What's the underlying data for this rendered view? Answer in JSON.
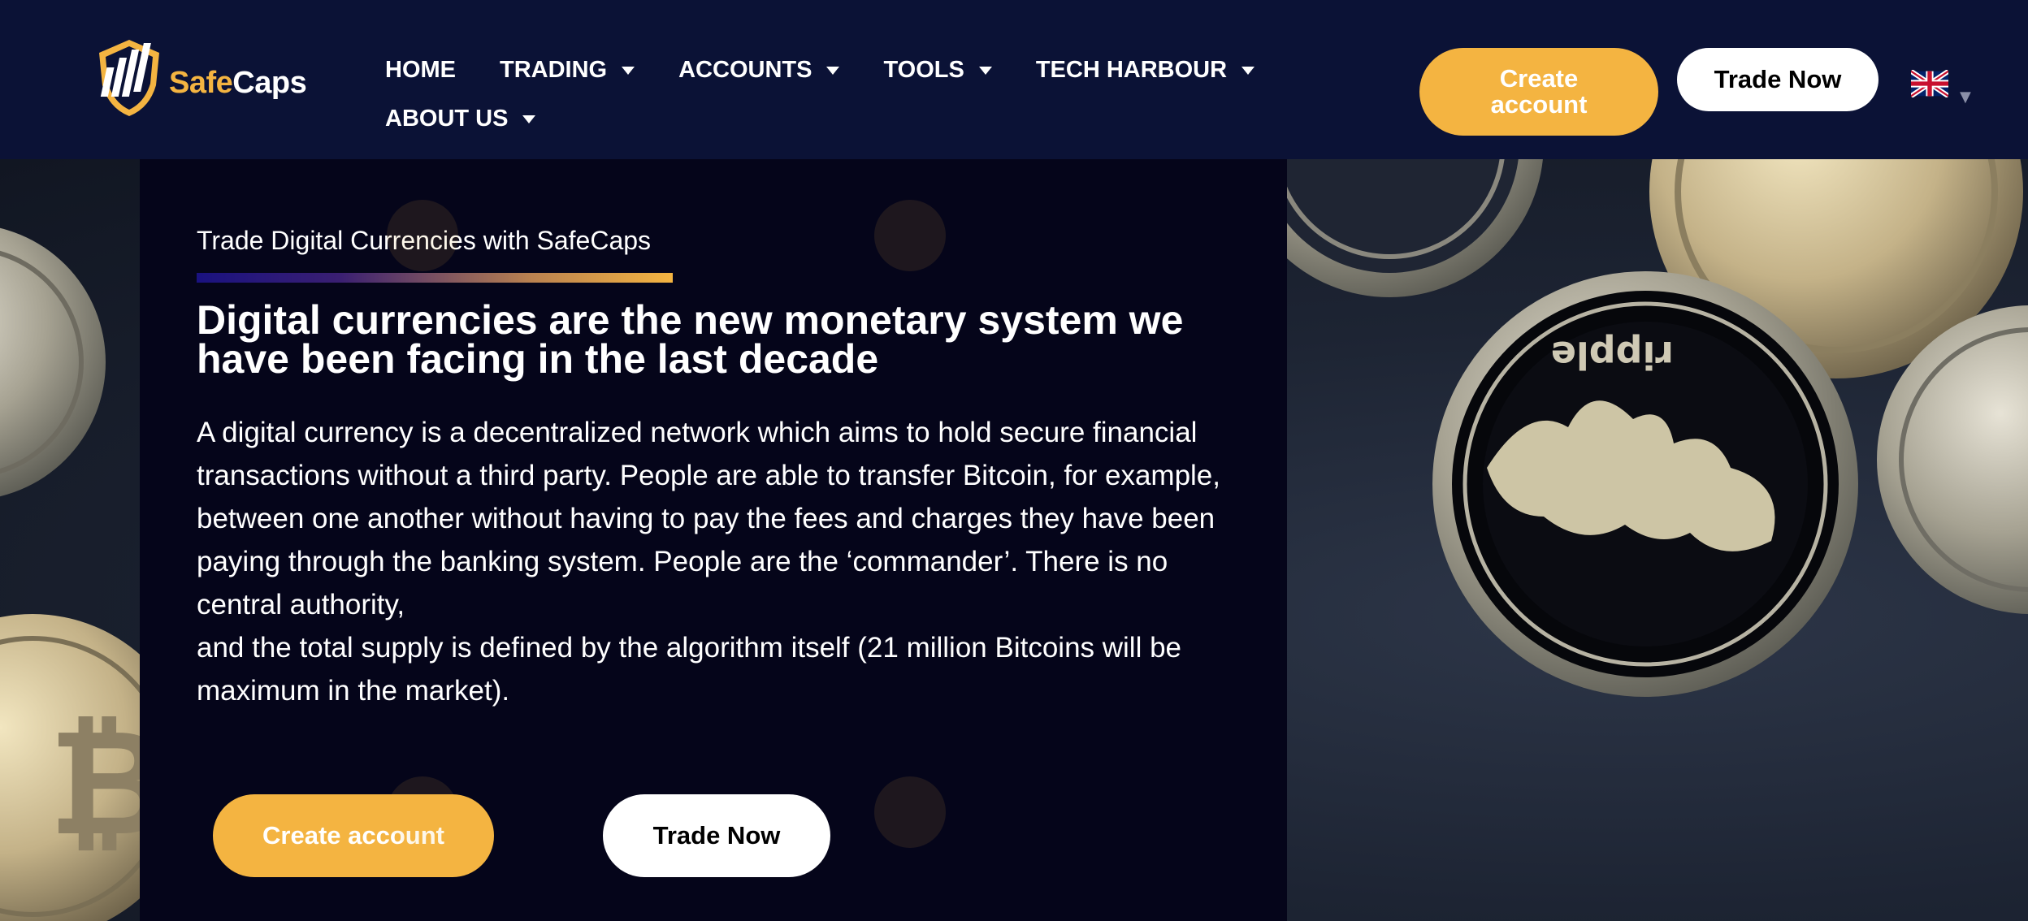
{
  "header": {
    "logo": {
      "text_primary": "Safe",
      "text_secondary": "Caps"
    },
    "nav": [
      {
        "label": "HOME",
        "has_dropdown": false
      },
      {
        "label": "TRADING",
        "has_dropdown": true
      },
      {
        "label": "ACCOUNTS",
        "has_dropdown": true
      },
      {
        "label": "TOOLS",
        "has_dropdown": true
      },
      {
        "label": "TECH HARBOUR",
        "has_dropdown": true
      },
      {
        "label": "ABOUT US",
        "has_dropdown": true
      }
    ],
    "create_account_label": "Create account",
    "trade_now_label": "Trade Now",
    "language_icon": "uk-flag-icon"
  },
  "hero": {
    "eyebrow": "Trade Digital Currencies with SafeCaps",
    "headline": "Digital currencies are the new monetary system we have been facing in the last decade",
    "paragraph_1": "A digital currency is a decentralized network which aims to hold secure financial transactions without a third party. People are able to transfer Bitcoin, for example, between one another without having to pay the fees and charges they have been paying through the banking system. People are the ‘commander’. There is no central authority,",
    "paragraph_2": "and the total supply is defined by the algorithm itself (21 million Bitcoins will be maximum in the market).",
    "create_account_label": "Create account",
    "trade_now_label": "Trade Now"
  },
  "background": {
    "coin_text": "ripple"
  },
  "colors": {
    "header_bg": "#0b1236",
    "panel_bg": "#05051a",
    "accent": "#f4b441",
    "white": "#ffffff"
  }
}
